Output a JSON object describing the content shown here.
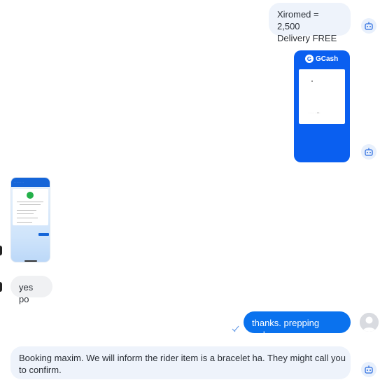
{
  "messages": {
    "m1": {
      "line1": "Xiromed = 2,500",
      "line2": "Delivery FREE"
    },
    "gcash": {
      "brand": "GCash"
    },
    "reply_yes": "yes po",
    "sent": "thanks. prepping order.",
    "booking": {
      "line1": "Booking maxim. We will inform the rider item is a bracelet ha. They might call you",
      "line2": "to confirm."
    }
  },
  "colors": {
    "accent": "#0a72ee",
    "gcash": "#0a5ff0",
    "bubble_light": "#eef3fb"
  },
  "icons": {
    "bot": "bot-icon",
    "read": "double-check-icon",
    "avatar": "user-avatar-icon"
  }
}
